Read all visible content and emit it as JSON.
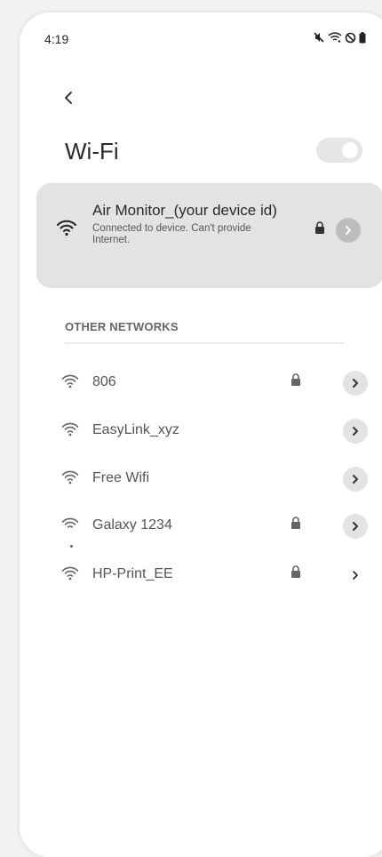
{
  "status_bar": {
    "time": "4:19",
    "icons": [
      "mute-icon",
      "wifi-icon",
      "dnd-icon",
      "battery-icon"
    ]
  },
  "header": {
    "back_icon": "chevron-left-icon",
    "title": "Wi-Fi",
    "wifi_enabled": true
  },
  "connected_network": {
    "name": "Air Monitor_(your device id)",
    "status": "Connected to device. Can't provide Internet.",
    "secured": true
  },
  "other_networks": {
    "label": "OTHER NETWORKS",
    "items": [
      {
        "name": "806",
        "secured": true
      },
      {
        "name": "EasyLink_xyz",
        "secured": false
      },
      {
        "name": "Free Wifi",
        "secured": false
      },
      {
        "name": "Galaxy 1234",
        "secured": true
      },
      {
        "name": "HP-Print_EE",
        "secured": true
      }
    ]
  },
  "colors": {
    "background": "#f2f2f2",
    "card": "#e3e3e3",
    "text": "#2b2b2b",
    "muted": "#666666"
  }
}
